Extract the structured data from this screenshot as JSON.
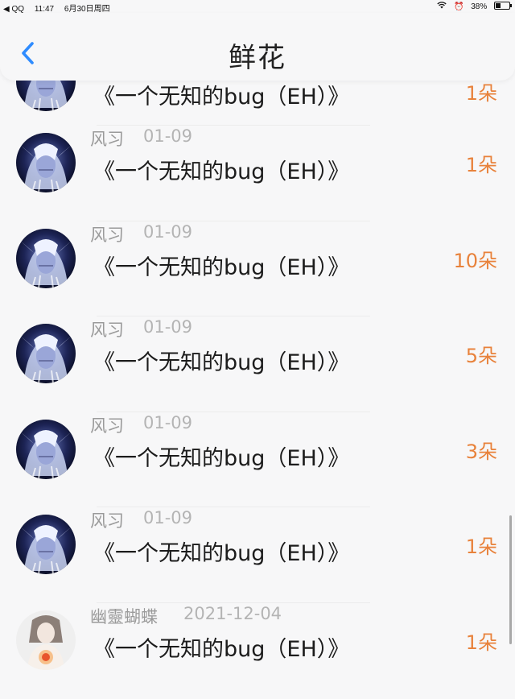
{
  "status_bar": {
    "carrier": "◀ QQ",
    "time": "11:47",
    "date": "6月30日周四",
    "battery": "38%"
  },
  "header": {
    "title": "鲜花"
  },
  "colors": {
    "accent_blue": "#2f8cff",
    "count_orange": "#e8823b"
  },
  "items": [
    {
      "name": "",
      "date": "",
      "message": "《一个无知的bug（EH）》",
      "count": "1朵",
      "avatar": "elf-avatar"
    },
    {
      "name": "风习",
      "date": "01-09",
      "message": "《一个无知的bug（EH）》",
      "count": "1朵",
      "avatar": "elf-avatar"
    },
    {
      "name": "风习",
      "date": "01-09",
      "message": "《一个无知的bug（EH）》",
      "count": "10朵",
      "avatar": "elf-avatar"
    },
    {
      "name": "风习",
      "date": "01-09",
      "message": "《一个无知的bug（EH）》",
      "count": "5朵",
      "avatar": "elf-avatar"
    },
    {
      "name": "风习",
      "date": "01-09",
      "message": "《一个无知的bug（EH）》",
      "count": "3朵",
      "avatar": "elf-avatar"
    },
    {
      "name": "风习",
      "date": "01-09",
      "message": "《一个无知的bug（EH）》",
      "count": "1朵",
      "avatar": "elf-avatar"
    },
    {
      "name": "幽靈蝴蝶",
      "date": "2021-12-04",
      "message": "《一个无知的bug（EH）》",
      "count": "1朵",
      "avatar": "girl-avatar"
    }
  ]
}
